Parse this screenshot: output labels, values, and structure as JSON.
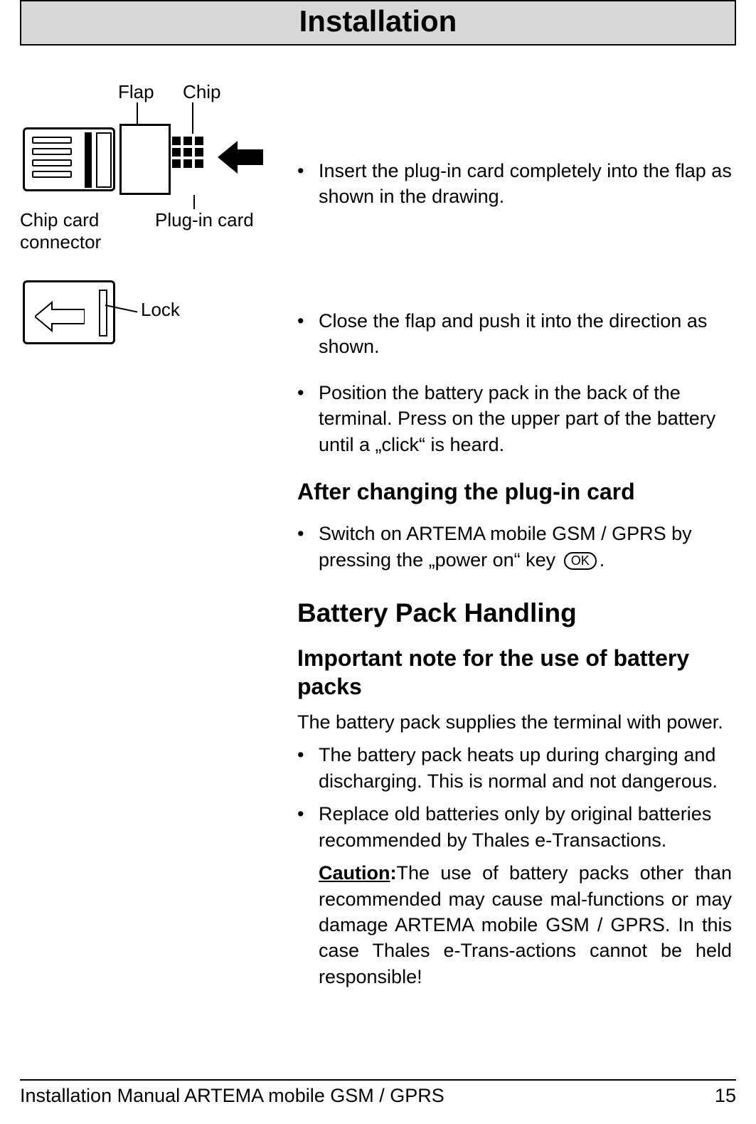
{
  "header": {
    "title": "Installation"
  },
  "diagram1": {
    "flap": "Flap",
    "chip": "Chip",
    "connector": "Chip card\nconnector",
    "plugin": "Plug-in card"
  },
  "diagram2": {
    "lock": "Lock"
  },
  "steps": {
    "s1": "Insert the plug-in card completely into the flap as shown in the drawing.",
    "s2": "Close the flap and push it into the direction as shown.",
    "s3": "Position the battery pack in the back of the terminal. Press on the upper part of the battery until a „click“ is heard."
  },
  "heading_after_change": "After changing the plug-in card",
  "step_after": {
    "pre": "Switch on ARTEMA mobile GSM / GPRS by pressing the „power on“ key",
    "key": "OK",
    "post": "."
  },
  "heading_battery": "Battery Pack Handling",
  "heading_note": "Important note for the use of battery packs",
  "note_intro": "The battery pack supplies the terminal with power.",
  "notes": {
    "n1": "The battery pack heats up during charging and discharging. This is normal and not dangerous.",
    "n2": "Replace old batteries only by original batteries recommended by Thales e-Transactions."
  },
  "caution": {
    "label": "Caution",
    "sep": ":",
    "text": "The use of battery packs other than recommended may cause mal-functions or may damage ARTEMA mobile GSM / GPRS. In this case Thales e-Trans-actions cannot be held responsible!"
  },
  "footer": {
    "left": "Installation Manual ARTEMA mobile GSM / GPRS",
    "right": "15"
  },
  "bullet": "•"
}
